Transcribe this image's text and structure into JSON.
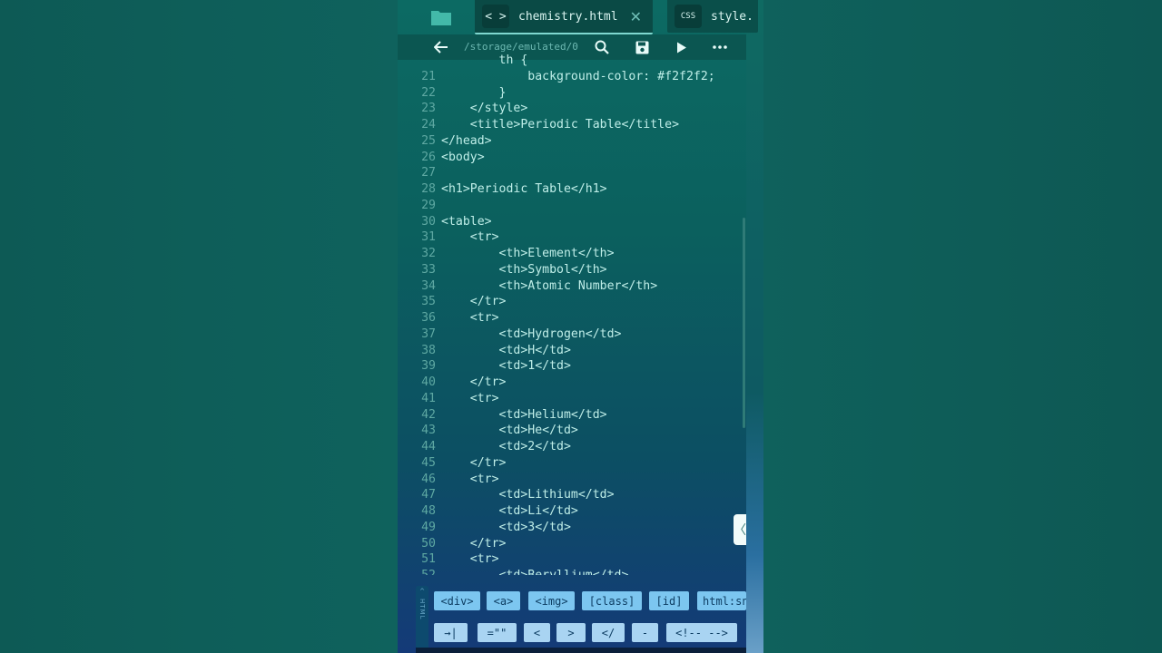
{
  "tabs": [
    {
      "icon": "code-brackets-icon",
      "icon_text": "< >",
      "title": "chemistry.html",
      "active": true
    },
    {
      "icon": "css-file-icon",
      "icon_text": "CSS",
      "title": "style.",
      "active": false
    }
  ],
  "toolbar": {
    "path": "/storage/emulated/0",
    "icons": [
      "back-arrow-icon",
      "search-icon",
      "save-icon",
      "play-icon",
      "more-icon"
    ]
  },
  "code": {
    "lines": [
      {
        "n": "",
        "t": "        th {"
      },
      {
        "n": "21",
        "t": "            background-color: #f2f2f2;"
      },
      {
        "n": "22",
        "t": "        }"
      },
      {
        "n": "23",
        "t": "    </style>"
      },
      {
        "n": "24",
        "t": "    <title>Periodic Table</title>"
      },
      {
        "n": "25",
        "t": "</head>"
      },
      {
        "n": "26",
        "t": "<body>"
      },
      {
        "n": "27",
        "t": ""
      },
      {
        "n": "28",
        "t": "<h1>Periodic Table</h1>"
      },
      {
        "n": "29",
        "t": ""
      },
      {
        "n": "30",
        "t": "<table>"
      },
      {
        "n": "31",
        "t": "    <tr>"
      },
      {
        "n": "32",
        "t": "        <th>Element</th>"
      },
      {
        "n": "33",
        "t": "        <th>Symbol</th>"
      },
      {
        "n": "34",
        "t": "        <th>Atomic Number</th>"
      },
      {
        "n": "35",
        "t": "    </tr>"
      },
      {
        "n": "36",
        "t": "    <tr>"
      },
      {
        "n": "37",
        "t": "        <td>Hydrogen</td>"
      },
      {
        "n": "38",
        "t": "        <td>H</td>"
      },
      {
        "n": "39",
        "t": "        <td>1</td>"
      },
      {
        "n": "40",
        "t": "    </tr>"
      },
      {
        "n": "41",
        "t": "    <tr>"
      },
      {
        "n": "42",
        "t": "        <td>Helium</td>"
      },
      {
        "n": "43",
        "t": "        <td>He</td>"
      },
      {
        "n": "44",
        "t": "        <td>2</td>"
      },
      {
        "n": "45",
        "t": "    </tr>"
      },
      {
        "n": "46",
        "t": "    <tr>"
      },
      {
        "n": "47",
        "t": "        <td>Lithium</td>"
      },
      {
        "n": "48",
        "t": "        <td>Li</td>"
      },
      {
        "n": "49",
        "t": "        <td>3</td>"
      },
      {
        "n": "50",
        "t": "    </tr>"
      },
      {
        "n": "51",
        "t": "    <tr>"
      },
      {
        "n": "52",
        "t": "        <td>Beryllium</td>"
      }
    ]
  },
  "snippets": {
    "row1": [
      "<div>",
      "<a>",
      "<img>",
      "[class]",
      "[id]",
      "html:sn"
    ],
    "row2": [
      "→|",
      "=\"\"",
      "<",
      ">",
      "</",
      "-",
      "<!-- -->"
    ]
  },
  "panel_label": "HTML"
}
